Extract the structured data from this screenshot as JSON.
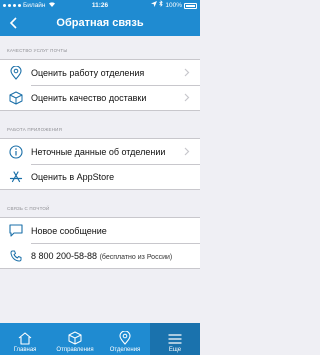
{
  "status": {
    "carrier": "Билайн",
    "time": "11:26",
    "battery": "100%"
  },
  "nav": {
    "title": "Обратная связь"
  },
  "sections": [
    {
      "header": "КАЧЕСТВО УСЛУГ ПОЧТЫ",
      "items": [
        {
          "label": "Оценить работу отделения",
          "icon": "location-pin-icon"
        },
        {
          "label": "Оценить качество доставки",
          "icon": "box-icon"
        }
      ]
    },
    {
      "header": "РАБОТА ПРИЛОЖЕНИЯ",
      "items": [
        {
          "label": "Неточные данные об отделении",
          "icon": "info-icon"
        },
        {
          "label": "Оценить в AppStore",
          "icon": "appstore-icon"
        }
      ]
    },
    {
      "header": "СВЯЗЬ С ПОЧТОЙ",
      "items": [
        {
          "label": "Новое сообщение",
          "icon": "chat-bubble-icon"
        },
        {
          "label": "8 800 200-58-88",
          "note": "(бесплатно из России)",
          "icon": "phone-icon"
        }
      ]
    }
  ],
  "tabs": [
    {
      "label": "Главная",
      "icon": "home-icon"
    },
    {
      "label": "Отправления",
      "icon": "parcel-icon"
    },
    {
      "label": "Отделения",
      "icon": "location-pin-icon"
    },
    {
      "label": "Еще",
      "icon": "menu-icon",
      "active": true
    }
  ],
  "colors": {
    "accent": "#1f8bd1",
    "icon": "#1a6fa8",
    "background": "#efeff4"
  }
}
